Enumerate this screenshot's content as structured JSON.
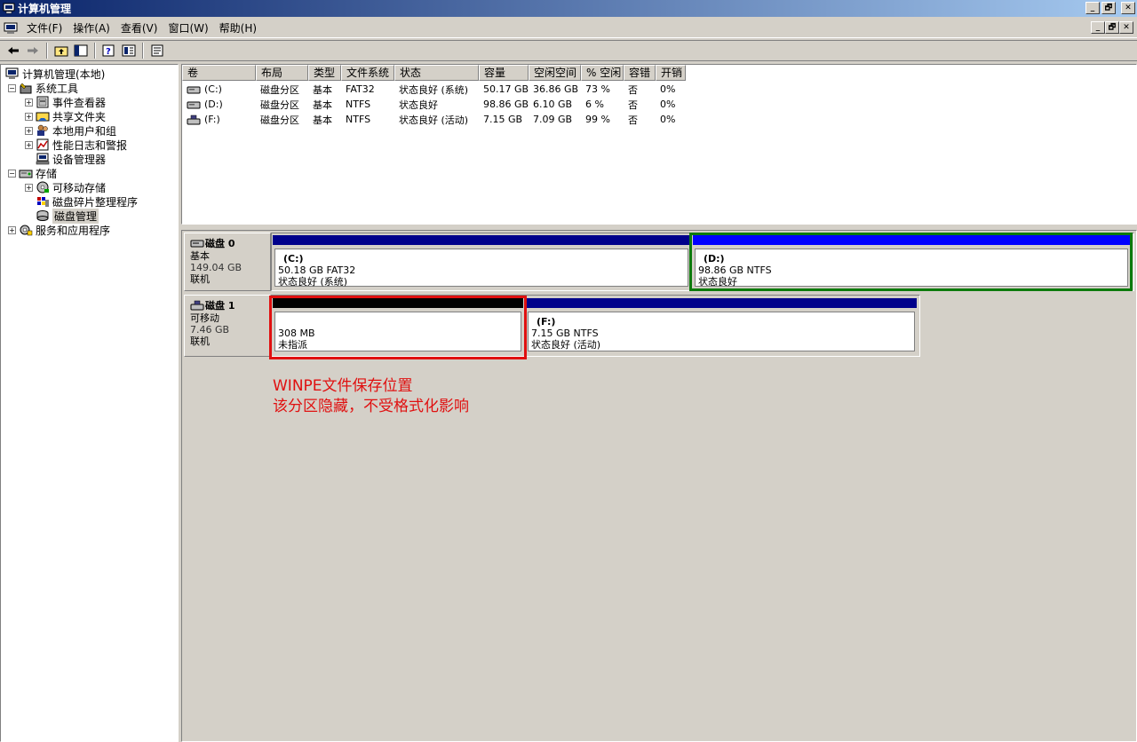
{
  "window": {
    "title": "计算机管理",
    "buttons": [
      "_",
      "🗗",
      "✕"
    ]
  },
  "menu": {
    "items": [
      "文件(F)",
      "操作(A)",
      "查看(V)",
      "窗口(W)",
      "帮助(H)"
    ]
  },
  "toolbar": {
    "icons": [
      "back-icon",
      "forward-icon",
      "up-folder-icon",
      "show-tree-icon",
      "help-icon",
      "properties-icon",
      "console-icon"
    ]
  },
  "tree": {
    "items": [
      {
        "label": "计算机管理(本地)",
        "level": 0,
        "expander": "",
        "icon": "computer-icon"
      },
      {
        "label": "系统工具",
        "level": 1,
        "expander": "−",
        "icon": "tools-icon"
      },
      {
        "label": "事件查看器",
        "level": 2,
        "expander": "+",
        "icon": "event-viewer-icon"
      },
      {
        "label": "共享文件夹",
        "level": 2,
        "expander": "+",
        "icon": "shared-folder-icon"
      },
      {
        "label": "本地用户和组",
        "level": 2,
        "expander": "+",
        "icon": "users-icon"
      },
      {
        "label": "性能日志和警报",
        "level": 2,
        "expander": "+",
        "icon": "performance-icon"
      },
      {
        "label": "设备管理器",
        "level": 2,
        "expander": "",
        "icon": "device-manager-icon"
      },
      {
        "label": "存储",
        "level": 1,
        "expander": "−",
        "icon": "storage-icon"
      },
      {
        "label": "可移动存储",
        "level": 2,
        "expander": "+",
        "icon": "removable-storage-icon"
      },
      {
        "label": "磁盘碎片整理程序",
        "level": 2,
        "expander": "",
        "icon": "defrag-icon"
      },
      {
        "label": "磁盘管理",
        "level": 2,
        "expander": "",
        "icon": "disk-management-icon",
        "selected": true
      },
      {
        "label": "服务和应用程序",
        "level": 1,
        "expander": "+",
        "icon": "services-icon"
      }
    ]
  },
  "volumes": {
    "columns": [
      "卷",
      "布局",
      "类型",
      "文件系统",
      "状态",
      "容量",
      "空闲空间",
      "% 空闲",
      "容错",
      "开销"
    ],
    "rows": [
      {
        "vol": "(C:)",
        "layout": "磁盘分区",
        "type": "基本",
        "fs": "FAT32",
        "status": "状态良好 (系统)",
        "capacity": "50.17 GB",
        "free": "36.86 GB",
        "pct": "73 %",
        "ft": "否",
        "overhead": "0%",
        "icon": "drive-icon"
      },
      {
        "vol": "(D:)",
        "layout": "磁盘分区",
        "type": "基本",
        "fs": "NTFS",
        "status": "状态良好",
        "capacity": "98.86 GB",
        "free": "6.10 GB",
        "pct": "6 %",
        "ft": "否",
        "overhead": "0%",
        "icon": "drive-icon"
      },
      {
        "vol": "(F:)",
        "layout": "磁盘分区",
        "type": "基本",
        "fs": "NTFS",
        "status": "状态良好 (活动)",
        "capacity": "7.15 GB",
        "free": "7.09 GB",
        "pct": "99 %",
        "ft": "否",
        "overhead": "0%",
        "icon": "usb-drive-icon"
      }
    ]
  },
  "disks": [
    {
      "name": "磁盘 0",
      "kind": "基本",
      "size": "149.04 GB",
      "state": "联机",
      "icon": "disk-icon",
      "partitions": [
        {
          "label": "(C:)",
          "size_fs": "50.18 GB FAT32",
          "status": "状态良好 (系统)",
          "bar_color": "#00008b"
        },
        {
          "label": "(D:)",
          "size_fs": "98.86 GB NTFS",
          "status": "状态良好",
          "bar_color": "#0000ff"
        }
      ]
    },
    {
      "name": "磁盘 1",
      "kind": "可移动",
      "size": "7.46 GB",
      "state": "联机",
      "icon": "removable-disk-icon",
      "partitions": [
        {
          "label": "",
          "size_fs": "308 MB",
          "status": "未指派",
          "bar_color": "#000000"
        },
        {
          "label": "(F:)",
          "size_fs": "7.15 GB NTFS",
          "status": "状态良好 (活动)",
          "bar_color": "#00008b"
        }
      ]
    }
  ],
  "annotation": {
    "line1": "WINPE文件保存位置",
    "line2": "该分区隐藏，不受格式化影响",
    "color": "#e01010"
  },
  "highlight_colors": {
    "green": "#0c7a0c",
    "red": "#e01010"
  }
}
